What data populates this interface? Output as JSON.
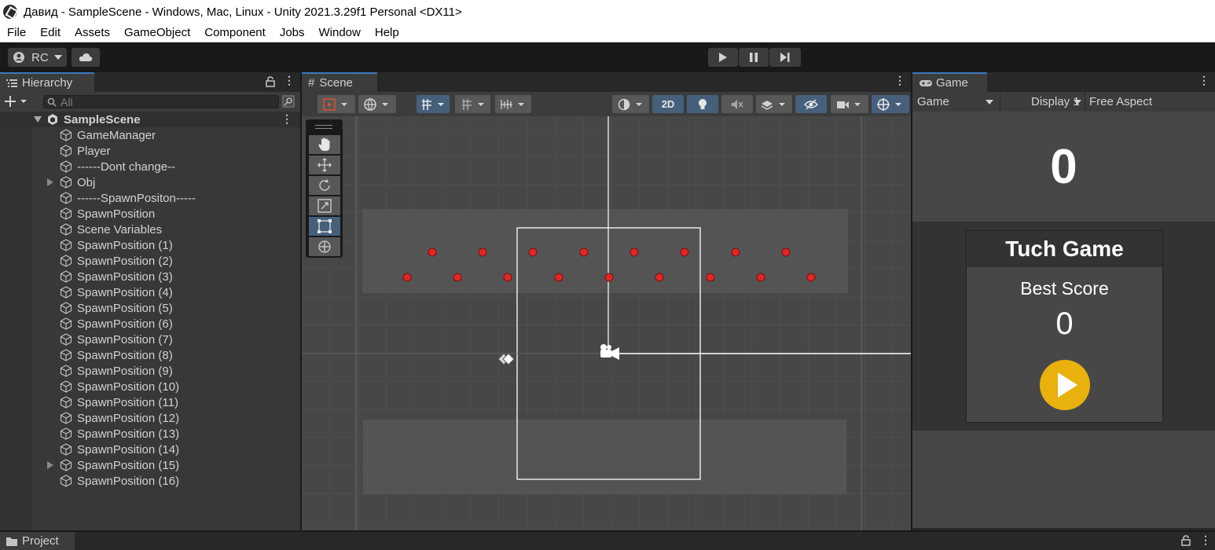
{
  "window": {
    "title": "Давид - SampleScene - Windows, Mac, Linux - Unity 2021.3.29f1 Personal <DX11>"
  },
  "menu": [
    "File",
    "Edit",
    "Assets",
    "GameObject",
    "Component",
    "Jobs",
    "Window",
    "Help"
  ],
  "toolbar": {
    "account_label": "RC"
  },
  "hierarchy": {
    "tab_label": "Hierarchy",
    "search_placeholder": "All",
    "scene_name": "SampleScene",
    "items": [
      {
        "label": "GameManager",
        "expandable": false
      },
      {
        "label": "Player",
        "expandable": false
      },
      {
        "label": "------Dont change--",
        "expandable": false
      },
      {
        "label": "Obj",
        "expandable": true
      },
      {
        "label": "------SpawnPositon-----",
        "expandable": false
      },
      {
        "label": "SpawnPosition",
        "expandable": false
      },
      {
        "label": "Scene Variables",
        "expandable": false
      },
      {
        "label": "SpawnPosition (1)",
        "expandable": false
      },
      {
        "label": "SpawnPosition (2)",
        "expandable": false
      },
      {
        "label": "SpawnPosition (3)",
        "expandable": false
      },
      {
        "label": "SpawnPosition (4)",
        "expandable": false
      },
      {
        "label": "SpawnPosition (5)",
        "expandable": false
      },
      {
        "label": "SpawnPosition (6)",
        "expandable": false
      },
      {
        "label": "SpawnPosition (7)",
        "expandable": false
      },
      {
        "label": "SpawnPosition (8)",
        "expandable": false
      },
      {
        "label": "SpawnPosition (9)",
        "expandable": false
      },
      {
        "label": "SpawnPosition (10)",
        "expandable": false
      },
      {
        "label": "SpawnPosition (11)",
        "expandable": false
      },
      {
        "label": "SpawnPosition (12)",
        "expandable": false
      },
      {
        "label": "SpawnPosition (13)",
        "expandable": false
      },
      {
        "label": "SpawnPosition (14)",
        "expandable": false
      },
      {
        "label": "SpawnPosition (15)",
        "expandable": true
      },
      {
        "label": "SpawnPosition (16)",
        "expandable": false
      }
    ]
  },
  "scene": {
    "tab_label": "Scene",
    "mode_2d_label": "2D"
  },
  "game": {
    "tab_label": "Game",
    "view_select": "Game",
    "display_select": "Display 1",
    "aspect_select": "Free Aspect",
    "score": "0",
    "menu_title": "Tuch Game",
    "best_score_label": "Best Score",
    "best_score": "0"
  },
  "project": {
    "tab_label": "Project"
  },
  "colors": {
    "accent": "#3a79bb",
    "spawn_point": "#e02626",
    "play_button": "#e8b10c"
  }
}
